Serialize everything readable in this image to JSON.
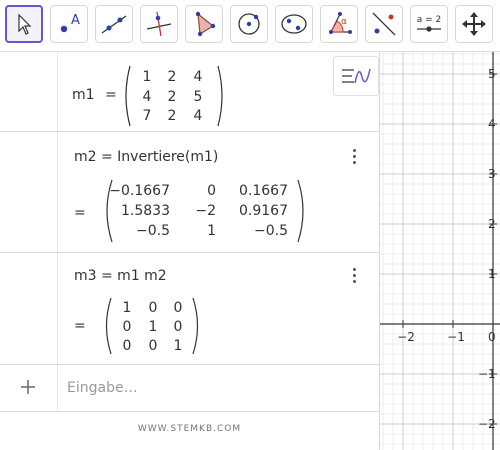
{
  "toolbar": {
    "tools": [
      {
        "name": "move-tool-icon",
        "active": true
      },
      {
        "name": "point-tool-icon",
        "label": "A"
      },
      {
        "name": "line-tool-icon"
      },
      {
        "name": "perpendicular-line-tool-icon"
      },
      {
        "name": "polygon-tool-icon"
      },
      {
        "name": "circle-center-point-tool-icon"
      },
      {
        "name": "conic-through-points-tool-icon"
      },
      {
        "name": "angle-tool-icon",
        "label": "α"
      },
      {
        "name": "reflect-tool-icon"
      },
      {
        "name": "slider-tool-icon",
        "label": "a = 2"
      },
      {
        "name": "move-graphics-view-tool-icon"
      }
    ],
    "accent_color": "#6557d2"
  },
  "algebra": {
    "rows": [
      {
        "name": "m1",
        "definition": "m1",
        "matrix": [
          [
            "1",
            "2",
            "4"
          ],
          [
            "4",
            "2",
            "5"
          ],
          [
            "7",
            "2",
            "4"
          ]
        ]
      },
      {
        "name": "m2",
        "definition": "m2 = Invertiere(m1)",
        "result_prefix": "=",
        "matrix": [
          [
            "−0.1667",
            "0",
            "0.1667"
          ],
          [
            "1.5833",
            "−2",
            "0.9167"
          ],
          [
            "−0.5",
            "1",
            "−0.5"
          ]
        ]
      },
      {
        "name": "m3",
        "definition": "m3 = m1 m2",
        "result_prefix": "=",
        "matrix": [
          [
            "1",
            "0",
            "0"
          ],
          [
            "0",
            "1",
            "0"
          ],
          [
            "0",
            "0",
            "1"
          ]
        ]
      }
    ],
    "m1_eq": "=",
    "input_placeholder": "Eingabe…",
    "add_symbol": "+"
  },
  "graphics": {
    "x_ticks": [
      "−2",
      "−1",
      "0"
    ],
    "y_ticks": [
      "5",
      "4",
      "3",
      "2",
      "1",
      "−1",
      "−2"
    ]
  },
  "footer": "WWW.STEMKB.COM"
}
